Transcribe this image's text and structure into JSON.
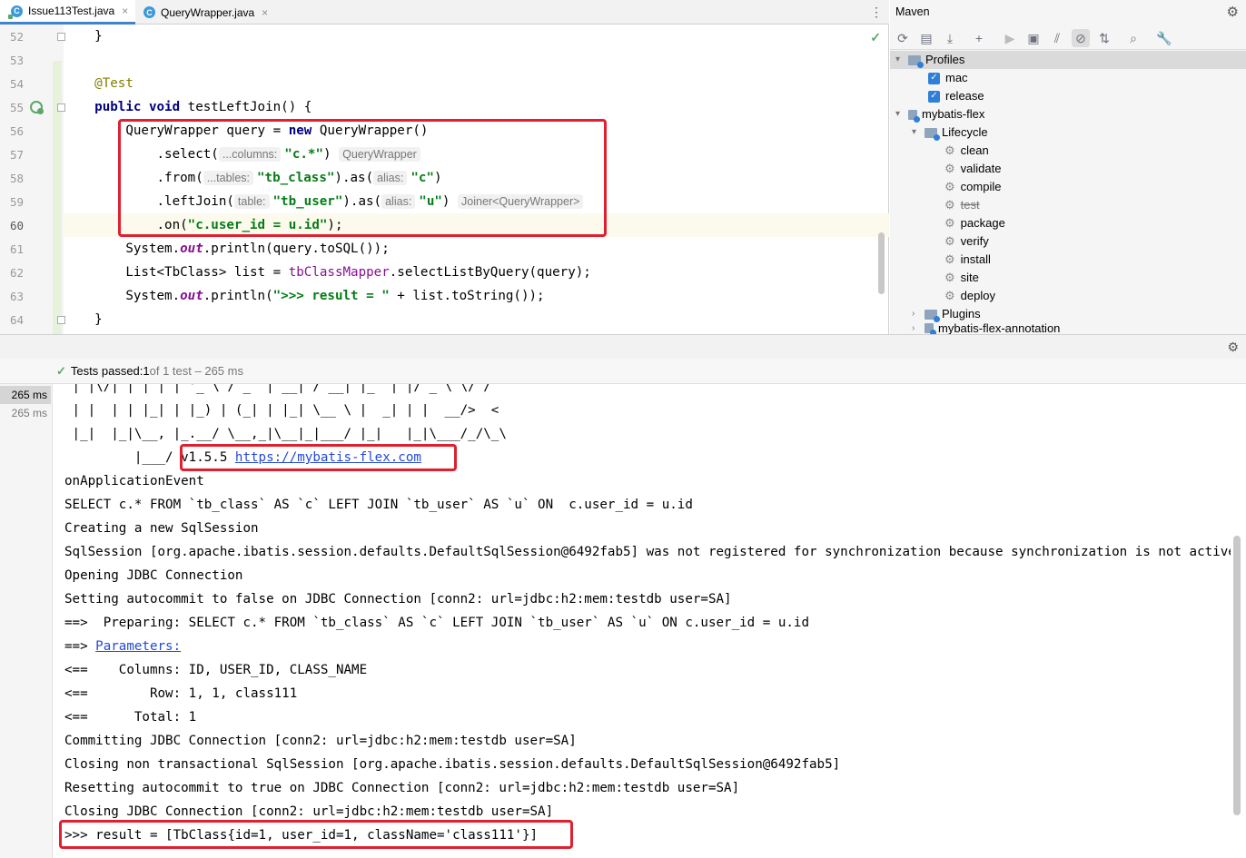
{
  "tabs": [
    {
      "label": "Issue113Test.java",
      "close": "×"
    },
    {
      "label": "QueryWrapper.java",
      "close": "×"
    }
  ],
  "tab_menu": "⋮",
  "editor": {
    "check": "✓",
    "lines": [
      {
        "num": "52"
      },
      {
        "num": "53"
      },
      {
        "num": "54"
      },
      {
        "num": "55"
      },
      {
        "num": "56"
      },
      {
        "num": "57"
      },
      {
        "num": "58"
      },
      {
        "num": "59"
      },
      {
        "num": "60"
      },
      {
        "num": "61"
      },
      {
        "num": "62"
      },
      {
        "num": "63"
      },
      {
        "num": "64"
      }
    ],
    "code": {
      "l52": "    }",
      "l54": "    @Test",
      "l55_kw": "public void",
      "l55_rest": " testLeftJoin() {",
      "l56_a": "        QueryWrapper query = ",
      "l56_kw": "new",
      "l56_b": " QueryWrapper()",
      "l57_a": "            .select(",
      "l57_hint": "...columns:",
      "l57_str": "\"c.*\"",
      "l57_b": ")",
      "l57_type": "QueryWrapper",
      "l58_a": "            .from(",
      "l58_hint": "...tables:",
      "l58_str": "\"tb_class\"",
      "l58_b": ").as(",
      "l58_hint2": "alias:",
      "l58_str2": "\"c\"",
      "l58_c": ")",
      "l59_a": "            .leftJoin(",
      "l59_hint": "table:",
      "l59_str": "\"tb_user\"",
      "l59_b": ").as(",
      "l59_hint2": "alias:",
      "l59_str2": "\"u\"",
      "l59_c": ")",
      "l59_type": "Joiner<QueryWrapper>",
      "l60_a": "            .on(",
      "l60_str": "\"c.user_id = u.id\"",
      "l60_b": ");",
      "l61_a": "        System.",
      "l61_fld": "out",
      "l61_b": ".println(query.toSQL());",
      "l62_a": "        List<TbClass> list = ",
      "l62_fld": "tbClassMapper",
      "l62_b": ".selectListByQuery(query);",
      "l63_a": "        System.",
      "l63_fld": "out",
      "l63_b": ".println(",
      "l63_str": "\">>> result = \"",
      "l63_c": " + list.toString());",
      "l64": "    }"
    }
  },
  "maven": {
    "title": "Maven",
    "gear": "⚙",
    "toolbar": [
      "⟳",
      "▤",
      "⤓",
      "+",
      "▶",
      "▣",
      "⫽",
      "⊘",
      "⇅",
      "⌕",
      "🔧"
    ],
    "tree": {
      "profiles": "Profiles",
      "mac": "mac",
      "release": "release",
      "project": "mybatis-flex",
      "lifecycle": "Lifecycle",
      "phases": [
        "clean",
        "validate",
        "compile",
        "test",
        "package",
        "verify",
        "install",
        "site",
        "deploy"
      ],
      "plugins": "Plugins",
      "next": "mybatis-flex-annotation"
    }
  },
  "tests": {
    "gear": "⚙",
    "check": "✓",
    "passed": "Tests passed: ",
    "count": "1",
    "of": " of 1 test – 265 ms",
    "times": [
      "265 ms",
      "265 ms"
    ]
  },
  "console": {
    "banner1": " | |\\/| | | | | '_ \\ / _` | __| / __| |_  | |/ _ \\ \\/ /",
    "banner2": " | |  | | |_| | |_) | (_| | |_| \\__ \\ |  _| | |  __/>  <",
    "banner3": " |_|  |_|\\__, |_.__/ \\__,_|\\__|_|___/ |_|   |_|\\___/_/\\_\\",
    "banner4_a": "         |___/ ",
    "version": "v1.5.5 ",
    "site": "https://mybatis-flex.com",
    "l_event": "onApplicationEvent",
    "l_select": "SELECT c.* FROM `tb_class` AS `c` LEFT JOIN `tb_user` AS `u` ON  c.user_id = u.id",
    "l_creating": "Creating a new SqlSession",
    "l_sqlsession": "SqlSession [org.apache.ibatis.session.defaults.DefaultSqlSession@6492fab5] was not registered for synchronization because synchronization is not active",
    "l_opening": "Opening JDBC Connection",
    "l_autocommit": "Setting autocommit to false on JDBC Connection [conn2: url=jdbc:h2:mem:testdb user=SA]",
    "l_preparing": "==>  Preparing: SELECT c.* FROM `tb_class` AS `c` LEFT JOIN `tb_user` AS `u` ON c.user_id = u.id",
    "l_params_a": "==> ",
    "l_params": "Parameters:",
    "l_columns": "<==    Columns: ID, USER_ID, CLASS_NAME",
    "l_row": "<==        Row: 1, 1, class111",
    "l_total": "<==      Total: 1",
    "l_committing": "Committing JDBC Connection [conn2: url=jdbc:h2:mem:testdb user=SA]",
    "l_closing_session": "Closing non transactional SqlSession [org.apache.ibatis.session.defaults.DefaultSqlSession@6492fab5]",
    "l_resetting": "Resetting autocommit to true on JDBC Connection [conn2: url=jdbc:h2:mem:testdb user=SA]",
    "l_closing_conn": "Closing JDBC Connection [conn2: url=jdbc:h2:mem:testdb user=SA]",
    "l_result": ">>> result = [TbClass{id=1, user_id=1, className='class111'}]"
  }
}
